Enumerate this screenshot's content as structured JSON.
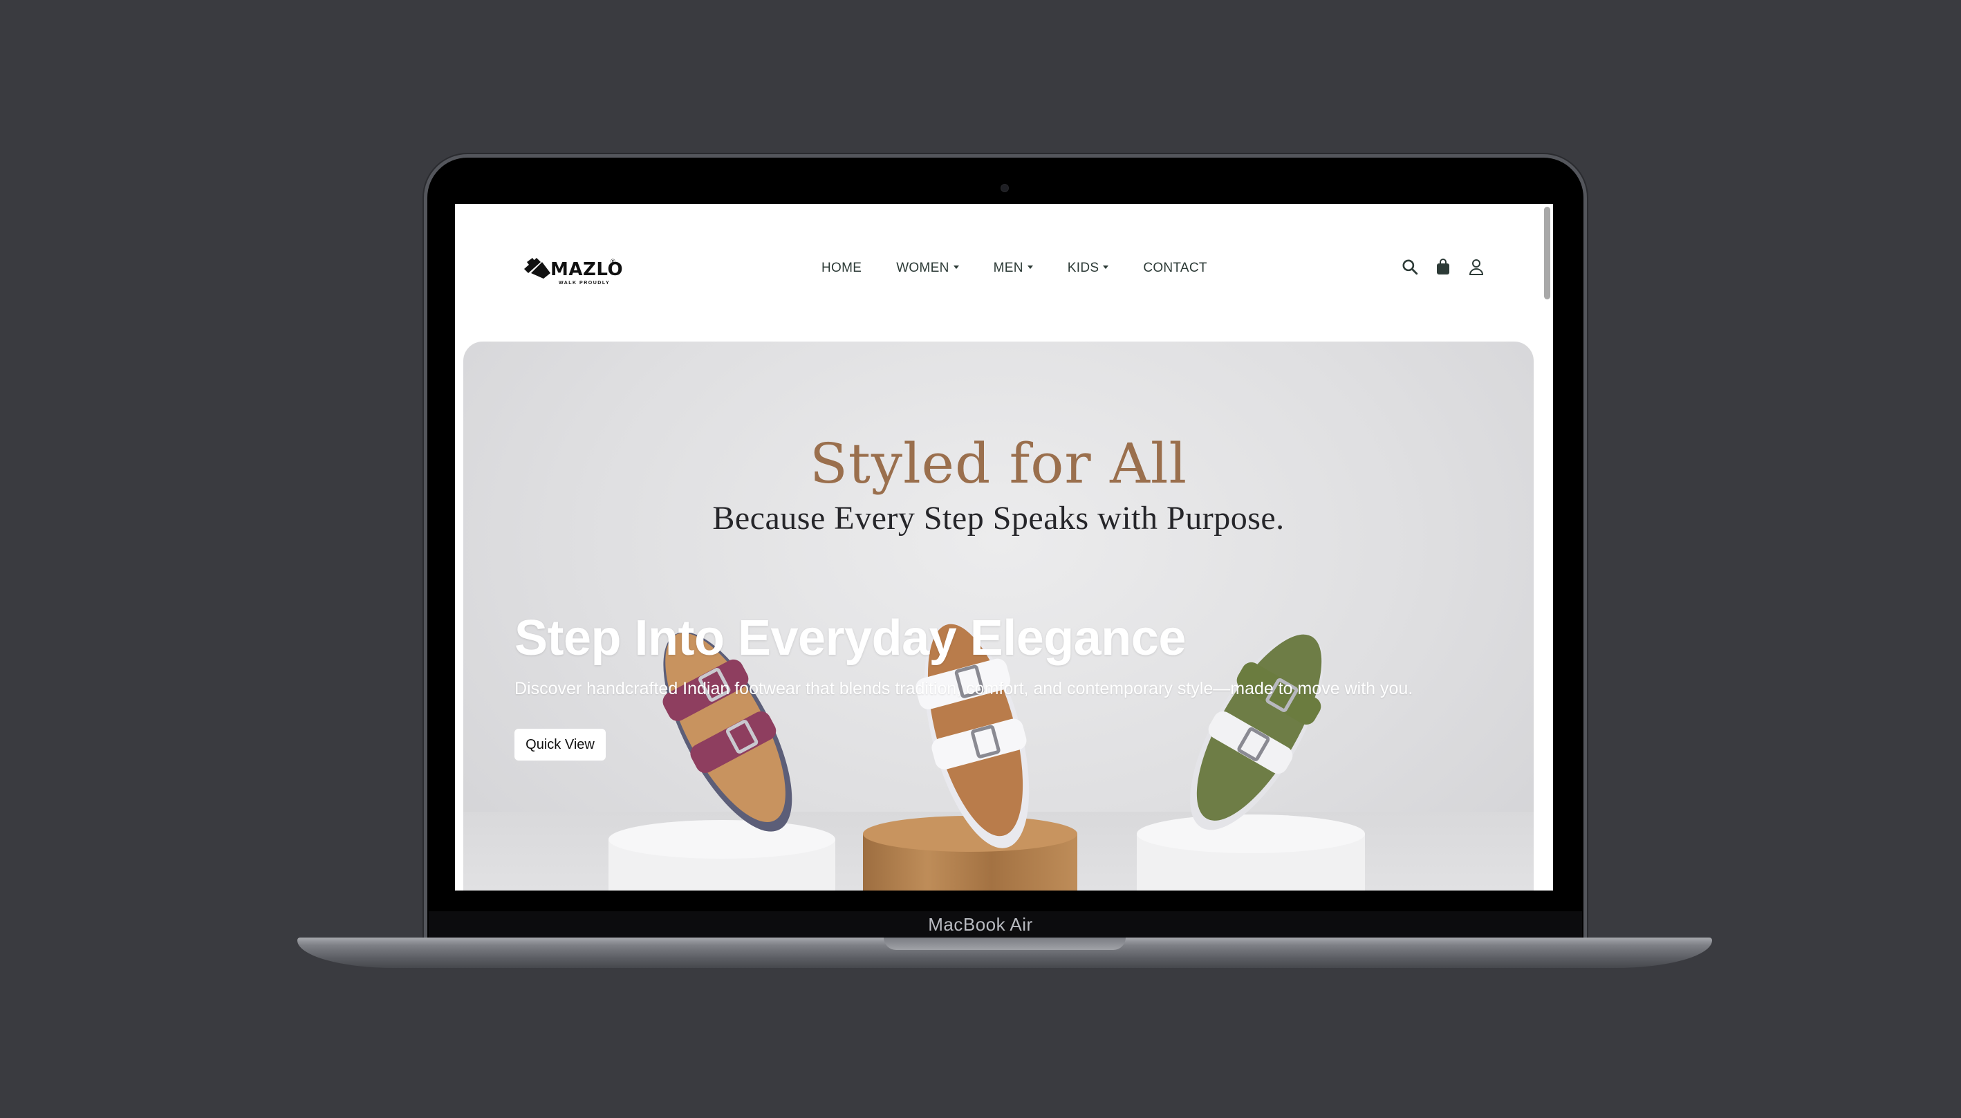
{
  "device": {
    "model_label": "MacBook Air"
  },
  "site": {
    "logo": {
      "wordmark": "MAZLO",
      "registered": "®",
      "tagline": "WALK PROUDLY"
    },
    "nav": [
      {
        "label": "HOME",
        "has_dropdown": false
      },
      {
        "label": "WOMEN",
        "has_dropdown": true
      },
      {
        "label": "MEN",
        "has_dropdown": true
      },
      {
        "label": "KIDS",
        "has_dropdown": true
      },
      {
        "label": "CONTACT",
        "has_dropdown": false
      }
    ],
    "header_icons": [
      "search-icon",
      "shopping-bag-icon",
      "user-icon"
    ]
  },
  "hero": {
    "script_title": "Styled for All",
    "script_subtitle": "Because Every Step Speaks with Purpose.",
    "heading": "Step Into Everyday Elegance",
    "description": "Discover handcrafted Indian footwear that blends tradition, comfort, and contemporary style—made to move with you.",
    "cta_label": "Quick View",
    "products": [
      "maroon-sandal",
      "white-sandal",
      "olive-sandal"
    ]
  },
  "colors": {
    "background": "#3a3b40",
    "script_title": "#9a6f4d",
    "nav_text": "#2c3a36",
    "hero_text": "#ffffff"
  }
}
